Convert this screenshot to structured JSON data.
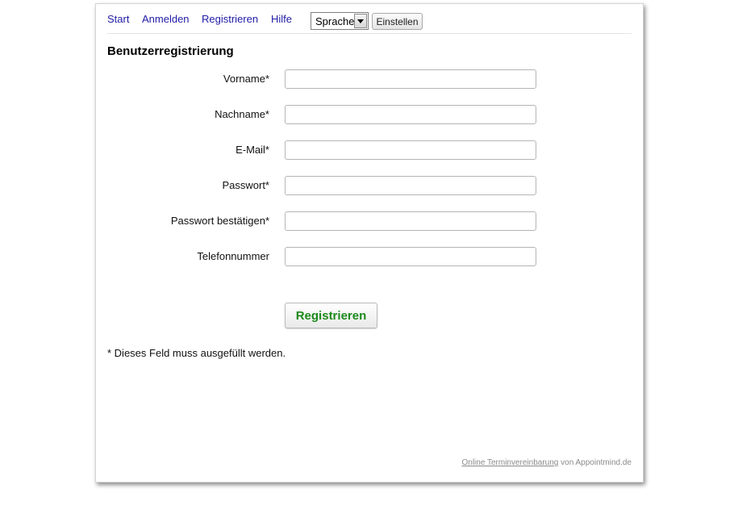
{
  "nav": {
    "links": [
      "Start",
      "Anmelden",
      "Registrieren",
      "Hilfe"
    ],
    "language_select": {
      "selected": "Sprache"
    },
    "apply_label": "Einstellen",
    "link_color": "#1f1aa6"
  },
  "form": {
    "title": "Benutzerregistrierung",
    "fields": [
      {
        "label": "Vorname*",
        "value": ""
      },
      {
        "label": "Nachname*",
        "value": ""
      },
      {
        "label": "E-Mail*",
        "value": ""
      },
      {
        "label": "Passwort*",
        "value": ""
      },
      {
        "label": "Passwort bestätigen*",
        "value": ""
      },
      {
        "label": "Telefonnummer",
        "value": ""
      }
    ],
    "submit_label": "Registrieren",
    "submit_color": "#1c8a1c",
    "required_note": "* Dieses Feld muss ausgefüllt werden."
  },
  "footer": {
    "link_text": "Online Terminvereinbarung",
    "suffix": "von Appointmind.de"
  }
}
